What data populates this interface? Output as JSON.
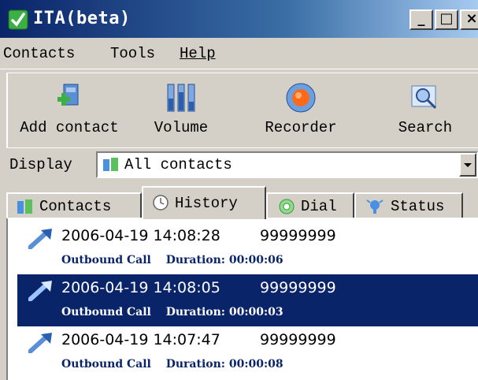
{
  "window": {
    "title": "ITA(beta)"
  },
  "menu": {
    "items": [
      "Contacts",
      "Tools",
      "Help"
    ]
  },
  "toolbar": {
    "add_contact": "Add contact",
    "volume": "Volume",
    "recorder": "Recorder",
    "search": "Search"
  },
  "display": {
    "label": "Display",
    "selected": "All contacts"
  },
  "tabs": [
    {
      "label": "Contacts",
      "icon": "contacts-icon"
    },
    {
      "label": "History",
      "icon": "clock-icon"
    },
    {
      "label": "Dial",
      "icon": "dial-icon"
    },
    {
      "label": "Status",
      "icon": "status-icon"
    }
  ],
  "active_tab": "History",
  "history": [
    {
      "datetime": "2006-04-19 14:08:28",
      "number": "99999999",
      "type": "Outbound Call",
      "duration_label": "Duration:",
      "duration": "00:00:06",
      "selected": false
    },
    {
      "datetime": "2006-04-19 14:08:05",
      "number": "99999999",
      "type": "Outbound Call",
      "duration_label": "Duration:",
      "duration": "00:00:03",
      "selected": true
    },
    {
      "datetime": "2006-04-19 14:07:47",
      "number": "99999999",
      "type": "Outbound Call",
      "duration_label": "Duration:",
      "duration": "00:00:08",
      "selected": false
    }
  ],
  "colors": {
    "selection": "#0a246a",
    "title_gradient_start": "#0a246a",
    "title_gradient_end": "#a6caf0",
    "face": "#d4d0c8"
  }
}
